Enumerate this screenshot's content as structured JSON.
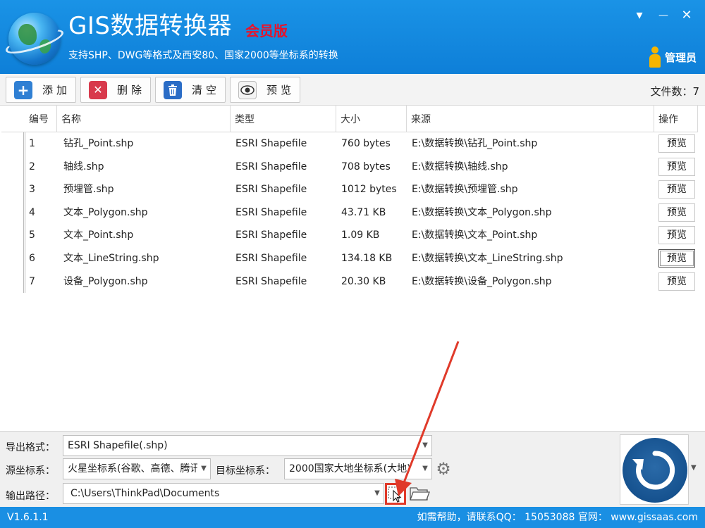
{
  "header": {
    "title": "GIS数据转换器",
    "edition": "会员版",
    "subtitle": "支持SHP、DWG等格式及西安80、国家2000等坐标系的转换",
    "user_label": "管理员",
    "controls": {
      "menu": "▾",
      "minimize": "—",
      "close": "✕"
    }
  },
  "toolbar": {
    "add_label": "添加",
    "delete_label": "删除",
    "clear_label": "清空",
    "preview_label": "预览",
    "file_count_label": "文件数：",
    "file_count": "7"
  },
  "table": {
    "columns": [
      "编号",
      "名称",
      "类型",
      "大小",
      "来源",
      "操作"
    ],
    "action_label": "预览",
    "rows": [
      {
        "id": "1",
        "name": "钻孔_Point.shp",
        "type": "ESRI Shapefile",
        "size": "760 bytes",
        "source": "E:\\数据转换\\钻孔_Point.shp"
      },
      {
        "id": "2",
        "name": "轴线.shp",
        "type": "ESRI Shapefile",
        "size": "708 bytes",
        "source": "E:\\数据转换\\轴线.shp"
      },
      {
        "id": "3",
        "name": "预埋管.shp",
        "type": "ESRI Shapefile",
        "size": "1012 bytes",
        "source": "E:\\数据转换\\预埋管.shp"
      },
      {
        "id": "4",
        "name": "文本_Polygon.shp",
        "type": "ESRI Shapefile",
        "size": "43.71 KB",
        "source": "E:\\数据转换\\文本_Polygon.shp"
      },
      {
        "id": "5",
        "name": "文本_Point.shp",
        "type": "ESRI Shapefile",
        "size": "1.09 KB",
        "source": "E:\\数据转换\\文本_Point.shp"
      },
      {
        "id": "6",
        "name": "文本_LineString.shp",
        "type": "ESRI Shapefile",
        "size": "134.18 KB",
        "source": "E:\\数据转换\\文本_LineString.shp"
      },
      {
        "id": "7",
        "name": "设备_Polygon.shp",
        "type": "ESRI Shapefile",
        "size": "20.30 KB",
        "source": "E:\\数据转换\\设备_Polygon.shp"
      }
    ]
  },
  "options": {
    "export_format_label": "导出格式：",
    "export_format_value": "ESRI Shapefile(.shp)",
    "source_crs_label": "源坐标系：",
    "source_crs_value": "火星坐标系(谷歌、高德、腾讯",
    "target_crs_label": "目标坐标系：",
    "target_crs_value": "2000国家大地坐标系(大地)",
    "output_path_label": "输出路径：",
    "output_path_value": "C:\\Users\\ThinkPad\\Documents"
  },
  "status": {
    "version": "V1.6.1.1",
    "help_text": "如需帮助，请联系QQ：  15053088   官网：  www.gissaas.com"
  },
  "colors": {
    "header_blue": "#1a93e6",
    "edition_red": "#e8132a",
    "add_icon": "#2f7fd3",
    "delete_icon": "#d8394c",
    "clear_icon": "#2a6cc6",
    "run_button": "#16528f",
    "annotation_red": "#e03a2a"
  }
}
